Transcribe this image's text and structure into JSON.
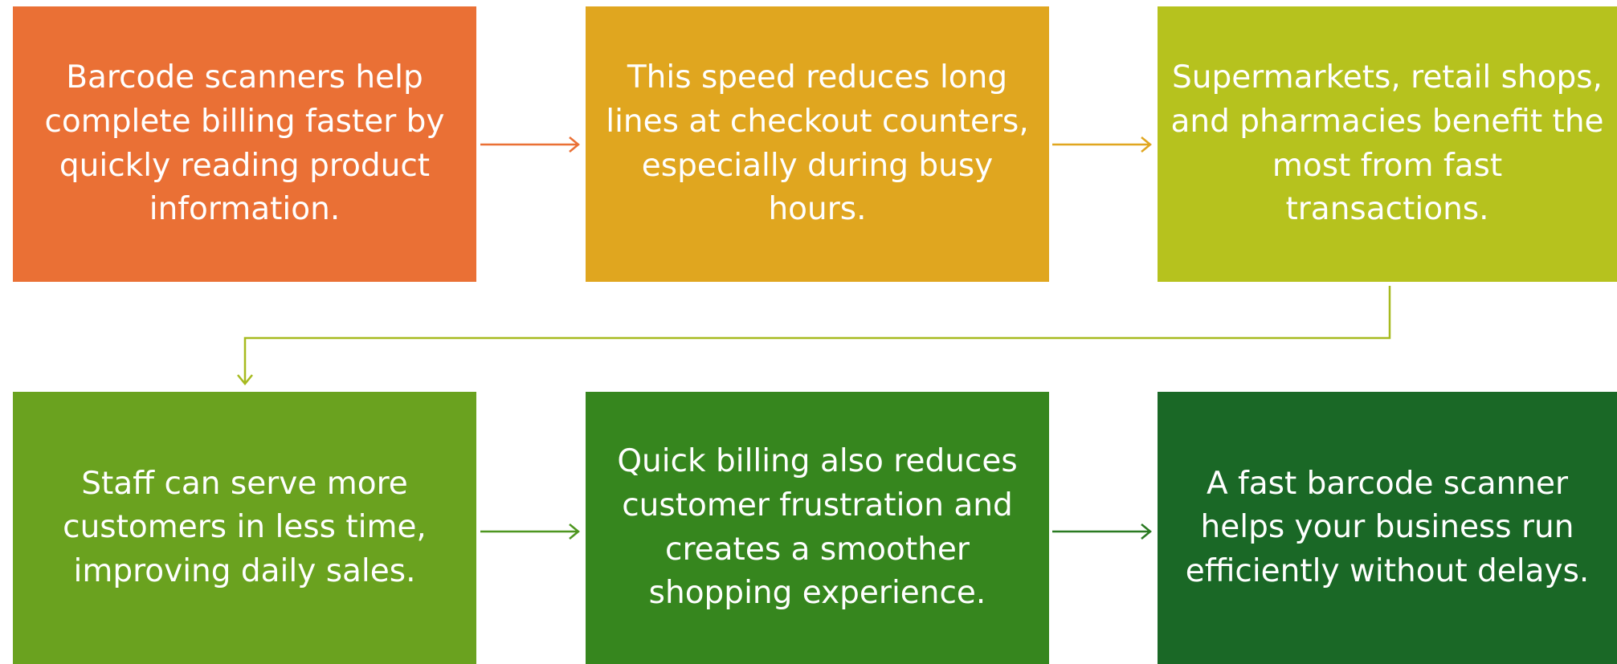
{
  "diagram": {
    "steps": [
      {
        "id": "step-1",
        "text": "Barcode scanners help complete billing faster by quickly reading product information.",
        "color": "#EA7035"
      },
      {
        "id": "step-2",
        "text": "This speed reduces long lines at checkout counters, especially during busy hours.",
        "color": "#E0A61F"
      },
      {
        "id": "step-3",
        "text": "Supermarkets, retail shops, and pharmacies benefit the most from fast transactions.",
        "color": "#B6C21E"
      },
      {
        "id": "step-4",
        "text": "Staff can serve more customers in less time, improving daily sales.",
        "color": "#6AA21F"
      },
      {
        "id": "step-5",
        "text": "Quick billing also reduces customer frustration and creates a smoother shopping experience.",
        "color": "#36861E"
      },
      {
        "id": "step-6",
        "text": "A fast barcode scanner helps your business run efficiently without delays.",
        "color": "#1A6826"
      }
    ],
    "connectors": [
      {
        "from": "step-1",
        "to": "step-2",
        "color": "#EA7035"
      },
      {
        "from": "step-2",
        "to": "step-3",
        "color": "#E0A61F"
      },
      {
        "from": "step-3",
        "to": "step-4",
        "color": "#A7BA1F"
      },
      {
        "from": "step-4",
        "to": "step-5",
        "color": "#4E9620"
      },
      {
        "from": "step-5",
        "to": "step-6",
        "color": "#2A7A22"
      }
    ]
  }
}
